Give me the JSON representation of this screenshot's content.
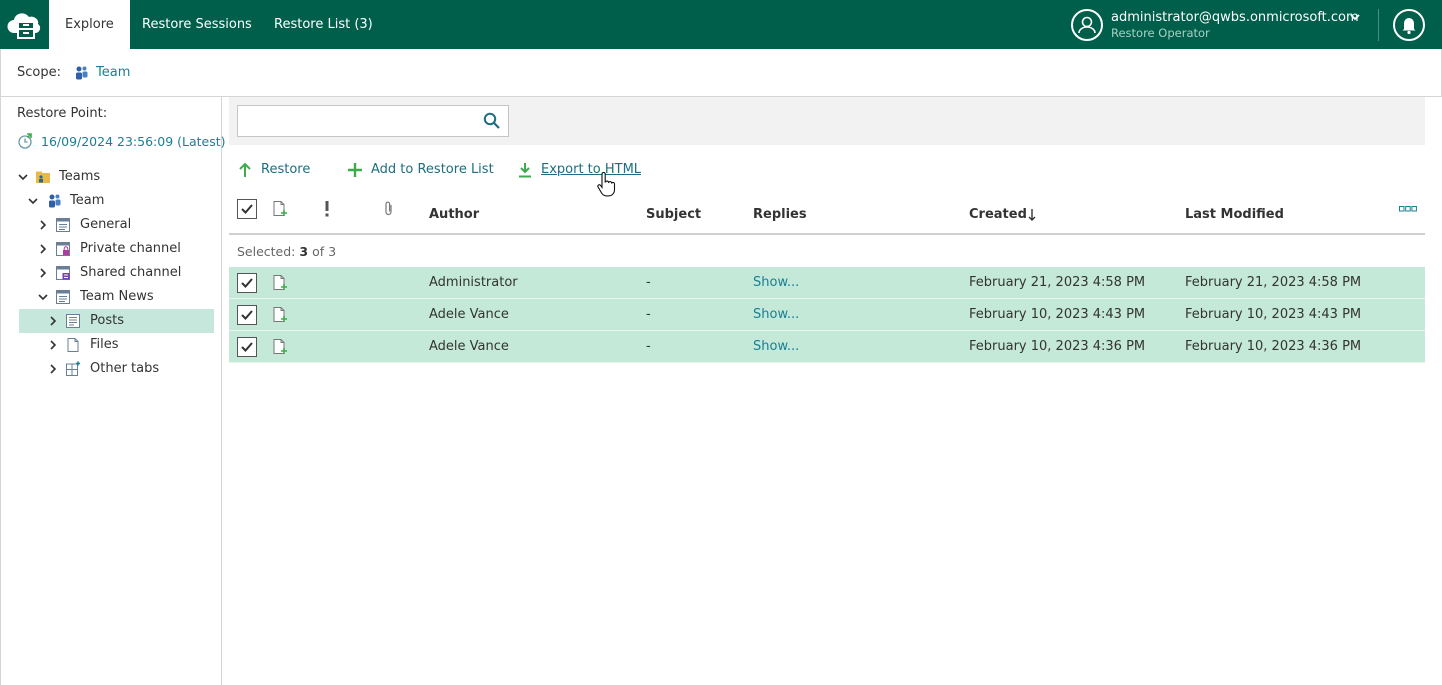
{
  "nav": {
    "tabs": [
      {
        "label": "Explore"
      },
      {
        "label": "Restore Sessions"
      },
      {
        "label": "Restore List (3)"
      }
    ],
    "user": {
      "email": "administrator@qwbs.onmicrosoft.com",
      "role": "Restore Operator"
    }
  },
  "scope": {
    "label": "Scope:",
    "value": "Team"
  },
  "restore_point": {
    "label": "Restore Point:",
    "value": "16/09/2024 23:56:09 (Latest)"
  },
  "tree": [
    {
      "label": "Teams",
      "expanded": true
    },
    {
      "label": "Team",
      "expanded": true
    },
    {
      "label": "General",
      "expanded": false
    },
    {
      "label": "Private channel",
      "expanded": false
    },
    {
      "label": "Shared channel",
      "expanded": false
    },
    {
      "label": "Team News",
      "expanded": true
    },
    {
      "label": "Posts",
      "expanded": false,
      "selected": true
    },
    {
      "label": "Files",
      "expanded": false
    },
    {
      "label": "Other tabs",
      "expanded": false
    }
  ],
  "search": {
    "value": "",
    "placeholder": ""
  },
  "toolbar": {
    "restore": "Restore",
    "add_to_restore_list": "Add to Restore List",
    "export_to_html": "Export to HTML"
  },
  "table": {
    "columns": {
      "author": "Author",
      "subject": "Subject",
      "replies": "Replies",
      "created": "Created",
      "last_modified": "Last Modified"
    },
    "selected": {
      "prefix": "Selected:",
      "count": "3",
      "suffix": "of 3"
    },
    "rows": [
      {
        "author": "Administrator",
        "subject": "-",
        "replies": "Show...",
        "created": "February 21, 2023 4:58 PM",
        "last_modified": "February 21, 2023 4:58 PM"
      },
      {
        "author": "Adele Vance",
        "subject": "-",
        "replies": "Show...",
        "created": "February 10, 2023 4:43 PM",
        "last_modified": "February 10, 2023 4:43 PM"
      },
      {
        "author": "Adele Vance",
        "subject": "-",
        "replies": "Show...",
        "created": "February 10, 2023 4:36 PM",
        "last_modified": "February 10, 2023 4:36 PM"
      }
    ]
  },
  "colors": {
    "brand": "#005f4b",
    "link": "#1a7f92",
    "row_selected": "#c4e9d9",
    "action_green": "#3cab4a"
  }
}
